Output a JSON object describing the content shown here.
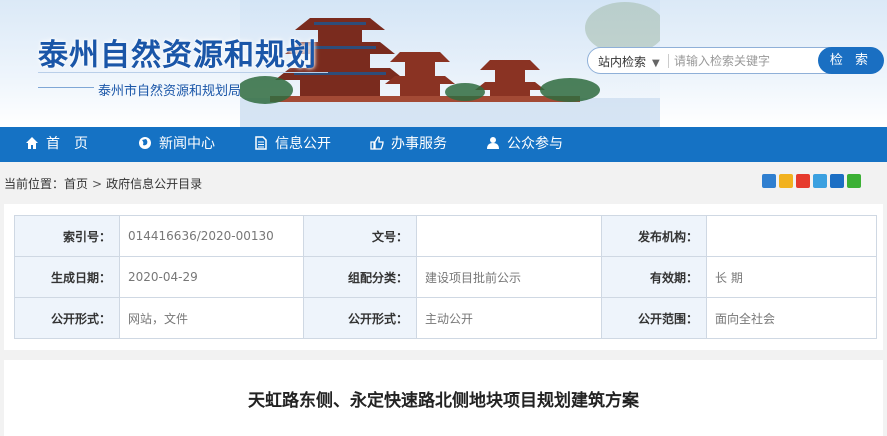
{
  "header": {
    "site_title": "泰州自然资源和规划",
    "site_subtitle": "泰州市自然资源和规划局",
    "search": {
      "scope": "站内检索",
      "placeholder": "请输入检索关键字",
      "button": "检 索"
    }
  },
  "nav": {
    "items": [
      {
        "label": "首　页",
        "icon": "home-icon"
      },
      {
        "label": "新闻中心",
        "icon": "globe-icon"
      },
      {
        "label": "信息公开",
        "icon": "document-icon"
      },
      {
        "label": "办事服务",
        "icon": "thumbs-up-icon"
      },
      {
        "label": "公众参与",
        "icon": "user-icon"
      }
    ]
  },
  "breadcrumb": {
    "prefix": "当前位置：",
    "items": [
      "首页",
      "政府信息公开目录"
    ],
    "separator": ">"
  },
  "share_icons": [
    "plus-share-icon",
    "qzone-icon",
    "weibo-icon",
    "tencent-icon",
    "renren-icon",
    "wechat-icon"
  ],
  "meta": {
    "rows": [
      [
        {
          "k": "索引号：",
          "v": "014416636/2020-00130"
        },
        {
          "k": "文号：",
          "v": ""
        },
        {
          "k": "发布机构：",
          "v": ""
        }
      ],
      [
        {
          "k": "生成日期：",
          "v": "2020-04-29"
        },
        {
          "k": "组配分类：",
          "v": "建设项目批前公示"
        },
        {
          "k": "有效期：",
          "v": "长 期"
        }
      ],
      [
        {
          "k": "公开形式：",
          "v": "网站，文件"
        },
        {
          "k": "公开形式：",
          "v": "主动公开"
        },
        {
          "k": "公开范围：",
          "v": "面向全社会"
        }
      ]
    ]
  },
  "article": {
    "title": "天虹路东侧、永定快速路北侧地块项目规划建筑方案"
  },
  "colors": {
    "nav_bg": "#1572c4",
    "brand_blue": "#1a56a8",
    "search_button": "#1a6fc2"
  }
}
